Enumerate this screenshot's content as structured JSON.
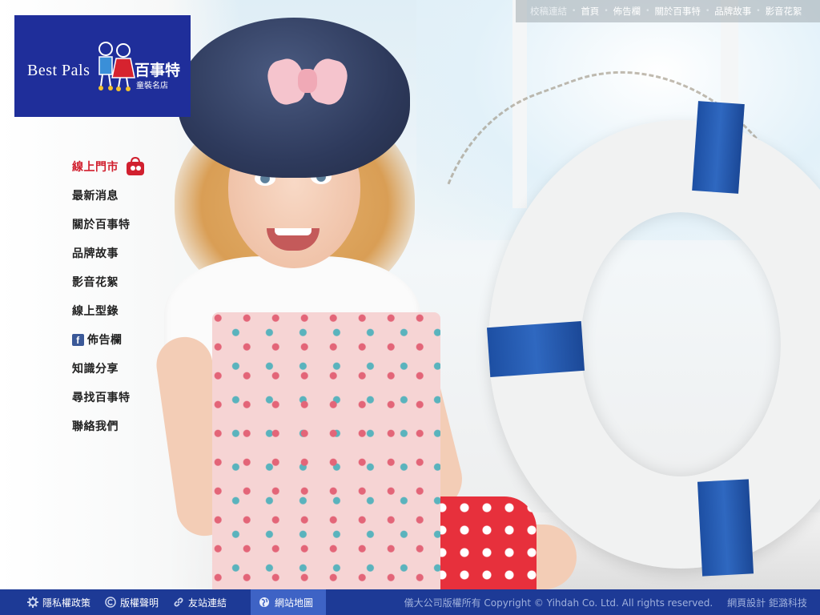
{
  "brand": {
    "name_en": "Best Pals",
    "name_zh": "百事特",
    "tagline": "童裝名店",
    "color": "#1f2e9a"
  },
  "nav": {
    "items": [
      {
        "label": "線上門市",
        "active": true,
        "icon": "shopping-bag-icon"
      },
      {
        "label": "最新消息"
      },
      {
        "label": "關於百事特"
      },
      {
        "label": "品牌故事"
      },
      {
        "label": "影音花絮"
      },
      {
        "label": "線上型錄"
      },
      {
        "label": "佈告欄",
        "icon": "facebook-icon"
      },
      {
        "label": "知識分享"
      },
      {
        "label": "尋找百事特"
      },
      {
        "label": "聯絡我們"
      }
    ],
    "active_color": "#d1202f"
  },
  "topnav": {
    "first": "校稿連結",
    "items": [
      "首頁",
      "佈告欄",
      "關於百事特",
      "品牌故事",
      "影音花絮"
    ]
  },
  "footer": {
    "privacy": "隱私權政策",
    "copyright_link": "版權聲明",
    "links": "友站連結",
    "sitemap": "網站地圖",
    "copyright_text": "儀大公司版權所有 Copyright © Yihdah Co. Ltd. All rights reserved.",
    "design_text": "網頁設計 鉅潞科技",
    "bg_color": "#1d3a96"
  },
  "icons": {
    "facebook": "f"
  }
}
